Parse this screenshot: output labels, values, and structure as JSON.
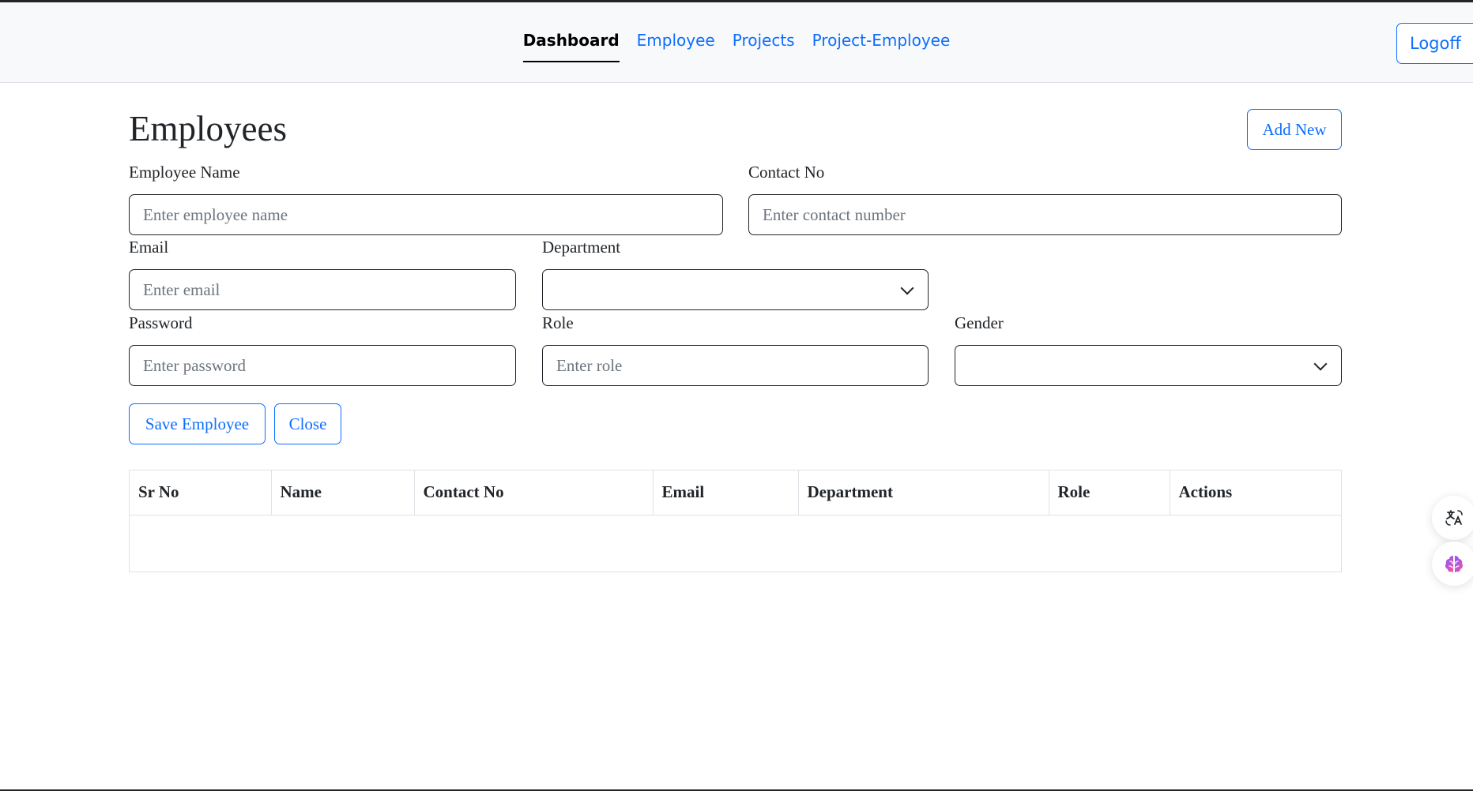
{
  "nav": {
    "links": [
      {
        "label": "Dashboard"
      },
      {
        "label": "Employee"
      },
      {
        "label": "Projects"
      },
      {
        "label": "Project-Employee"
      }
    ],
    "logoff_label": "Logoff"
  },
  "page": {
    "title": "Employees",
    "add_new_label": "Add New"
  },
  "form": {
    "employee_name": {
      "label": "Employee Name",
      "placeholder": "Enter employee name",
      "value": ""
    },
    "contact_no": {
      "label": "Contact No",
      "placeholder": "Enter contact number",
      "value": ""
    },
    "email": {
      "label": "Email",
      "placeholder": "Enter email",
      "value": ""
    },
    "department": {
      "label": "Department",
      "value": ""
    },
    "password": {
      "label": "Password",
      "placeholder": "Enter password",
      "value": ""
    },
    "role": {
      "label": "Role",
      "placeholder": "Enter role",
      "value": ""
    },
    "gender": {
      "label": "Gender",
      "value": ""
    },
    "save_label": "Save Employee",
    "close_label": "Close"
  },
  "table": {
    "columns": [
      "Sr No",
      "Name",
      "Contact No",
      "Email",
      "Department",
      "Role",
      "Actions"
    ],
    "rows": []
  },
  "side_buttons": [
    {
      "icon": "translate-icon"
    },
    {
      "icon": "brain-icon"
    }
  ],
  "colors": {
    "primary": "#0d6efd",
    "navbar_bg": "#f8f9fa",
    "border": "#dee2e6"
  }
}
